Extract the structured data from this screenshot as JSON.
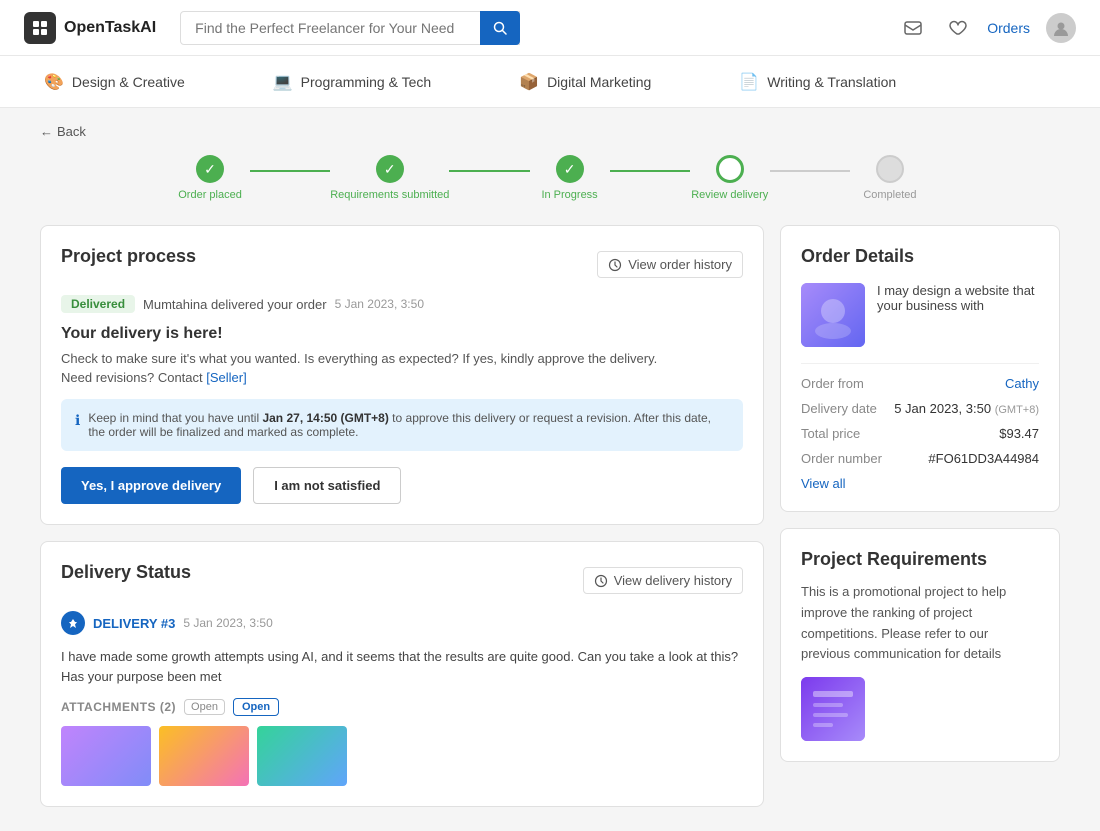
{
  "header": {
    "logo_text": "OpenTaskAI",
    "search_placeholder": "Find the Perfect Freelancer for Your Need",
    "orders_label": "Orders"
  },
  "nav": {
    "items": [
      {
        "id": "design",
        "icon": "🎨",
        "label": "Design & Creative"
      },
      {
        "id": "programming",
        "icon": "💻",
        "label": "Programming & Tech"
      },
      {
        "id": "marketing",
        "icon": "📦",
        "label": "Digital Marketing"
      },
      {
        "id": "writing",
        "icon": "📄",
        "label": "Writing & Translation"
      }
    ]
  },
  "back_label": "Back",
  "progress": {
    "steps": [
      {
        "id": "order-placed",
        "label": "Order placed",
        "status": "done"
      },
      {
        "id": "requirements",
        "label": "Requirements submitted",
        "status": "done"
      },
      {
        "id": "in-progress",
        "label": "In Progress",
        "status": "done"
      },
      {
        "id": "review",
        "label": "Review delivery",
        "status": "active"
      },
      {
        "id": "completed",
        "label": "Completed",
        "status": "pending"
      }
    ]
  },
  "project_process": {
    "title": "Project process",
    "view_history_label": "View order history",
    "badge": "Delivered",
    "delivered_by": "Mumtahina delivered your order",
    "delivered_time": "5 Jan 2023, 3:50",
    "heading": "Your delivery is here!",
    "body1": "Check to make sure it's what you wanted. Is everything as expected? If yes, kindly approve the delivery.",
    "body2": "Need revisions? Contact [Seller]",
    "info_text": "Keep in mind that you have until ",
    "info_date": "Jan 27, 14:50 (GMT+8)",
    "info_text2": " to approve this delivery or request a revision. After this date, the order will be finalized and marked as complete.",
    "approve_label": "Yes, I approve delivery",
    "not_satisfied_label": "I am not satisfied"
  },
  "order_details": {
    "title": "Order Details",
    "thumb_text": "I may design a website that your business with",
    "order_from_label": "Order from",
    "order_from_value": "Cathy",
    "delivery_date_label": "Delivery date",
    "delivery_date_value": "5 Jan 2023, 3:50",
    "delivery_date_tz": "(GMT+8)",
    "total_price_label": "Total price",
    "total_price_value": "$93.47",
    "order_number_label": "Order number",
    "order_number_value": "#FO61DD3A44984",
    "view_all_label": "View all"
  },
  "delivery_status": {
    "title": "Delivery Status",
    "view_history_label": "View delivery history",
    "delivery_num": "DELIVERY #3",
    "delivery_time": "5 Jan 2023, 3:50",
    "body": "I have made some growth attempts using AI, and it seems that the results are quite good. Can you take a look at this? Has your purpose been met",
    "attachments_label": "ATTACHMENTS (2)",
    "open_label": "Open",
    "open_outline_label": "Open"
  },
  "project_requirements": {
    "title": "Project Requirements",
    "text": "This is a promotional project to help improve the ranking of project competitions. Please refer to our previous communication for details"
  }
}
